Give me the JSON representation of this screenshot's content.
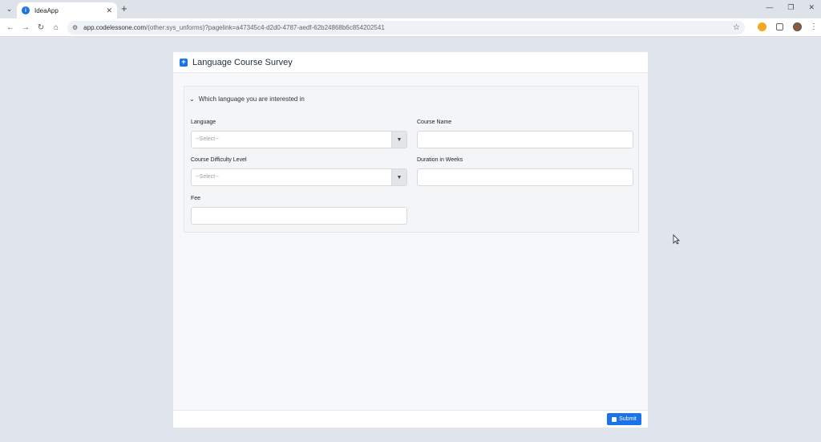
{
  "browser": {
    "tab_title": "IdeaApp",
    "url_host": "app.codelessone.com",
    "url_path": "/(other:sys_unforms)?pagelink=a47345c4-d2d0-4787-aedf-62b24868b6c854202541"
  },
  "form": {
    "title": "Language Course Survey",
    "section_title": "Which language you are interested in",
    "fields": {
      "language": {
        "label": "Language",
        "placeholder": "--Select--"
      },
      "course_name": {
        "label": "Course Name",
        "value": ""
      },
      "difficulty": {
        "label": "Course Difficulty Level",
        "placeholder": "--Select--"
      },
      "duration": {
        "label": "Duration in Weeks",
        "value": ""
      },
      "fee": {
        "label": "Fee",
        "value": ""
      }
    },
    "submit_label": "Submit"
  }
}
